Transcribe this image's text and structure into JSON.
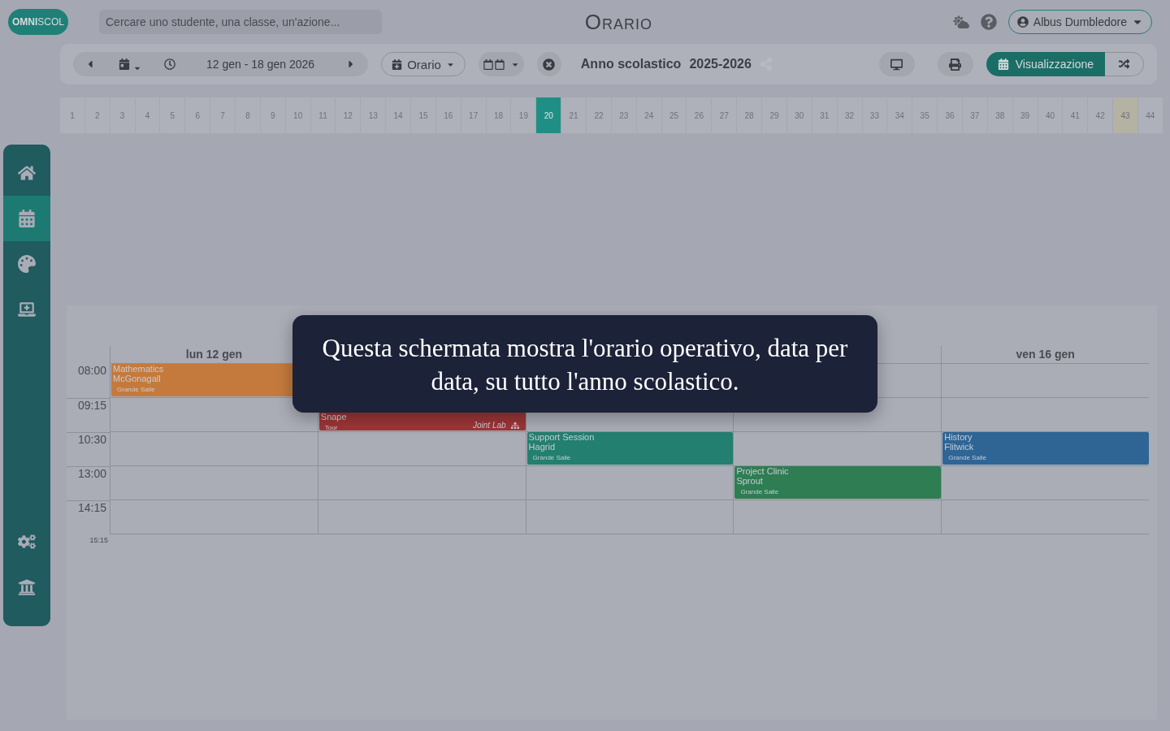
{
  "header": {
    "logo": {
      "part1": "OMNI",
      "part2": "SCOL"
    },
    "search": {
      "placeholder": "Cercare uno studente, una classe, un'azione..."
    },
    "title": "Orario",
    "user": "Albus Dumbledore"
  },
  "toolbar": {
    "date_range": "12 gen - 18 gen 2026",
    "view_menu": "Orario",
    "year_label": "Anno scolastico",
    "year": "2025-2026",
    "display_button": {
      "label": "Visualizzazione",
      "selected": true
    }
  },
  "weeks": [
    {
      "label": "1",
      "selected": false,
      "highlighted": false
    },
    {
      "label": "2",
      "selected": false,
      "highlighted": false
    },
    {
      "label": "3",
      "selected": false,
      "highlighted": false
    },
    {
      "label": "4",
      "selected": false,
      "highlighted": false
    },
    {
      "label": "5",
      "selected": false,
      "highlighted": false
    },
    {
      "label": "6",
      "selected": false,
      "highlighted": false
    },
    {
      "label": "7",
      "selected": false,
      "highlighted": false
    },
    {
      "label": "8",
      "selected": false,
      "highlighted": false
    },
    {
      "label": "9",
      "selected": false,
      "highlighted": false
    },
    {
      "label": "10",
      "selected": false,
      "highlighted": false
    },
    {
      "label": "11",
      "selected": false,
      "highlighted": false
    },
    {
      "label": "12",
      "selected": false,
      "highlighted": false
    },
    {
      "label": "13",
      "selected": false,
      "highlighted": false
    },
    {
      "label": "14",
      "selected": false,
      "highlighted": false
    },
    {
      "label": "15",
      "selected": false,
      "highlighted": false
    },
    {
      "label": "16",
      "selected": false,
      "highlighted": false
    },
    {
      "label": "17",
      "selected": false,
      "highlighted": false
    },
    {
      "label": "18",
      "selected": false,
      "highlighted": false
    },
    {
      "label": "19",
      "selected": false,
      "highlighted": false
    },
    {
      "label": "20",
      "selected": true,
      "highlighted": false
    },
    {
      "label": "21",
      "selected": false,
      "highlighted": false
    },
    {
      "label": "22",
      "selected": false,
      "highlighted": false
    },
    {
      "label": "23",
      "selected": false,
      "highlighted": false
    },
    {
      "label": "24",
      "selected": false,
      "highlighted": false
    },
    {
      "label": "25",
      "selected": false,
      "highlighted": false
    },
    {
      "label": "26",
      "selected": false,
      "highlighted": false
    },
    {
      "label": "27",
      "selected": false,
      "highlighted": false
    },
    {
      "label": "28",
      "selected": false,
      "highlighted": false
    },
    {
      "label": "29",
      "selected": false,
      "highlighted": false
    },
    {
      "label": "30",
      "selected": false,
      "highlighted": false
    },
    {
      "label": "31",
      "selected": false,
      "highlighted": false
    },
    {
      "label": "32",
      "selected": false,
      "highlighted": false
    },
    {
      "label": "33",
      "selected": false,
      "highlighted": false
    },
    {
      "label": "34",
      "selected": false,
      "highlighted": false
    },
    {
      "label": "35",
      "selected": false,
      "highlighted": false
    },
    {
      "label": "36",
      "selected": false,
      "highlighted": false
    },
    {
      "label": "37",
      "selected": false,
      "highlighted": false
    },
    {
      "label": "38",
      "selected": false,
      "highlighted": false
    },
    {
      "label": "39",
      "selected": false,
      "highlighted": false
    },
    {
      "label": "40",
      "selected": false,
      "highlighted": false
    },
    {
      "label": "41",
      "selected": false,
      "highlighted": false
    },
    {
      "label": "42",
      "selected": false,
      "highlighted": false
    },
    {
      "label": "43",
      "selected": false,
      "highlighted": true
    },
    {
      "label": "44",
      "selected": false,
      "highlighted": false
    }
  ],
  "sidebar": {
    "items": [
      {
        "selected": false
      },
      {
        "selected": true
      },
      {
        "selected": false
      },
      {
        "selected": false
      }
    ],
    "bottom_items": [
      {
        "selected": false
      },
      {
        "selected": false
      }
    ]
  },
  "calendar": {
    "first_day": "lun 12 gen",
    "last_day": "ven 16 gen",
    "times": [
      "08:00",
      "09:15",
      "10:30",
      "13:00",
      "14:15"
    ],
    "end_time": "15:15",
    "events": [
      {
        "title": "Mathematics",
        "teacher": "McGonagall",
        "room": "Grande Salle",
        "color": "#c47a3c"
      },
      {
        "teacher": "Snape",
        "room": "Tour",
        "group": "Joint Lab",
        "color": "#9c3537"
      },
      {
        "title": "Support Session",
        "teacher": "Hagrid",
        "room": "Grande Salle",
        "color": "#237f70"
      },
      {
        "title": "Project Clinic",
        "teacher": "Sprout",
        "room": "Grande Salle",
        "color": "#2e7d53"
      },
      {
        "title": "History",
        "teacher": "Flitwick",
        "room": "Grande Salle",
        "color": "#2f6595"
      }
    ]
  },
  "tooltip": {
    "text": "Questa schermata mostra l'orario operativo, data per data, su tutto l'anno scolastico."
  }
}
